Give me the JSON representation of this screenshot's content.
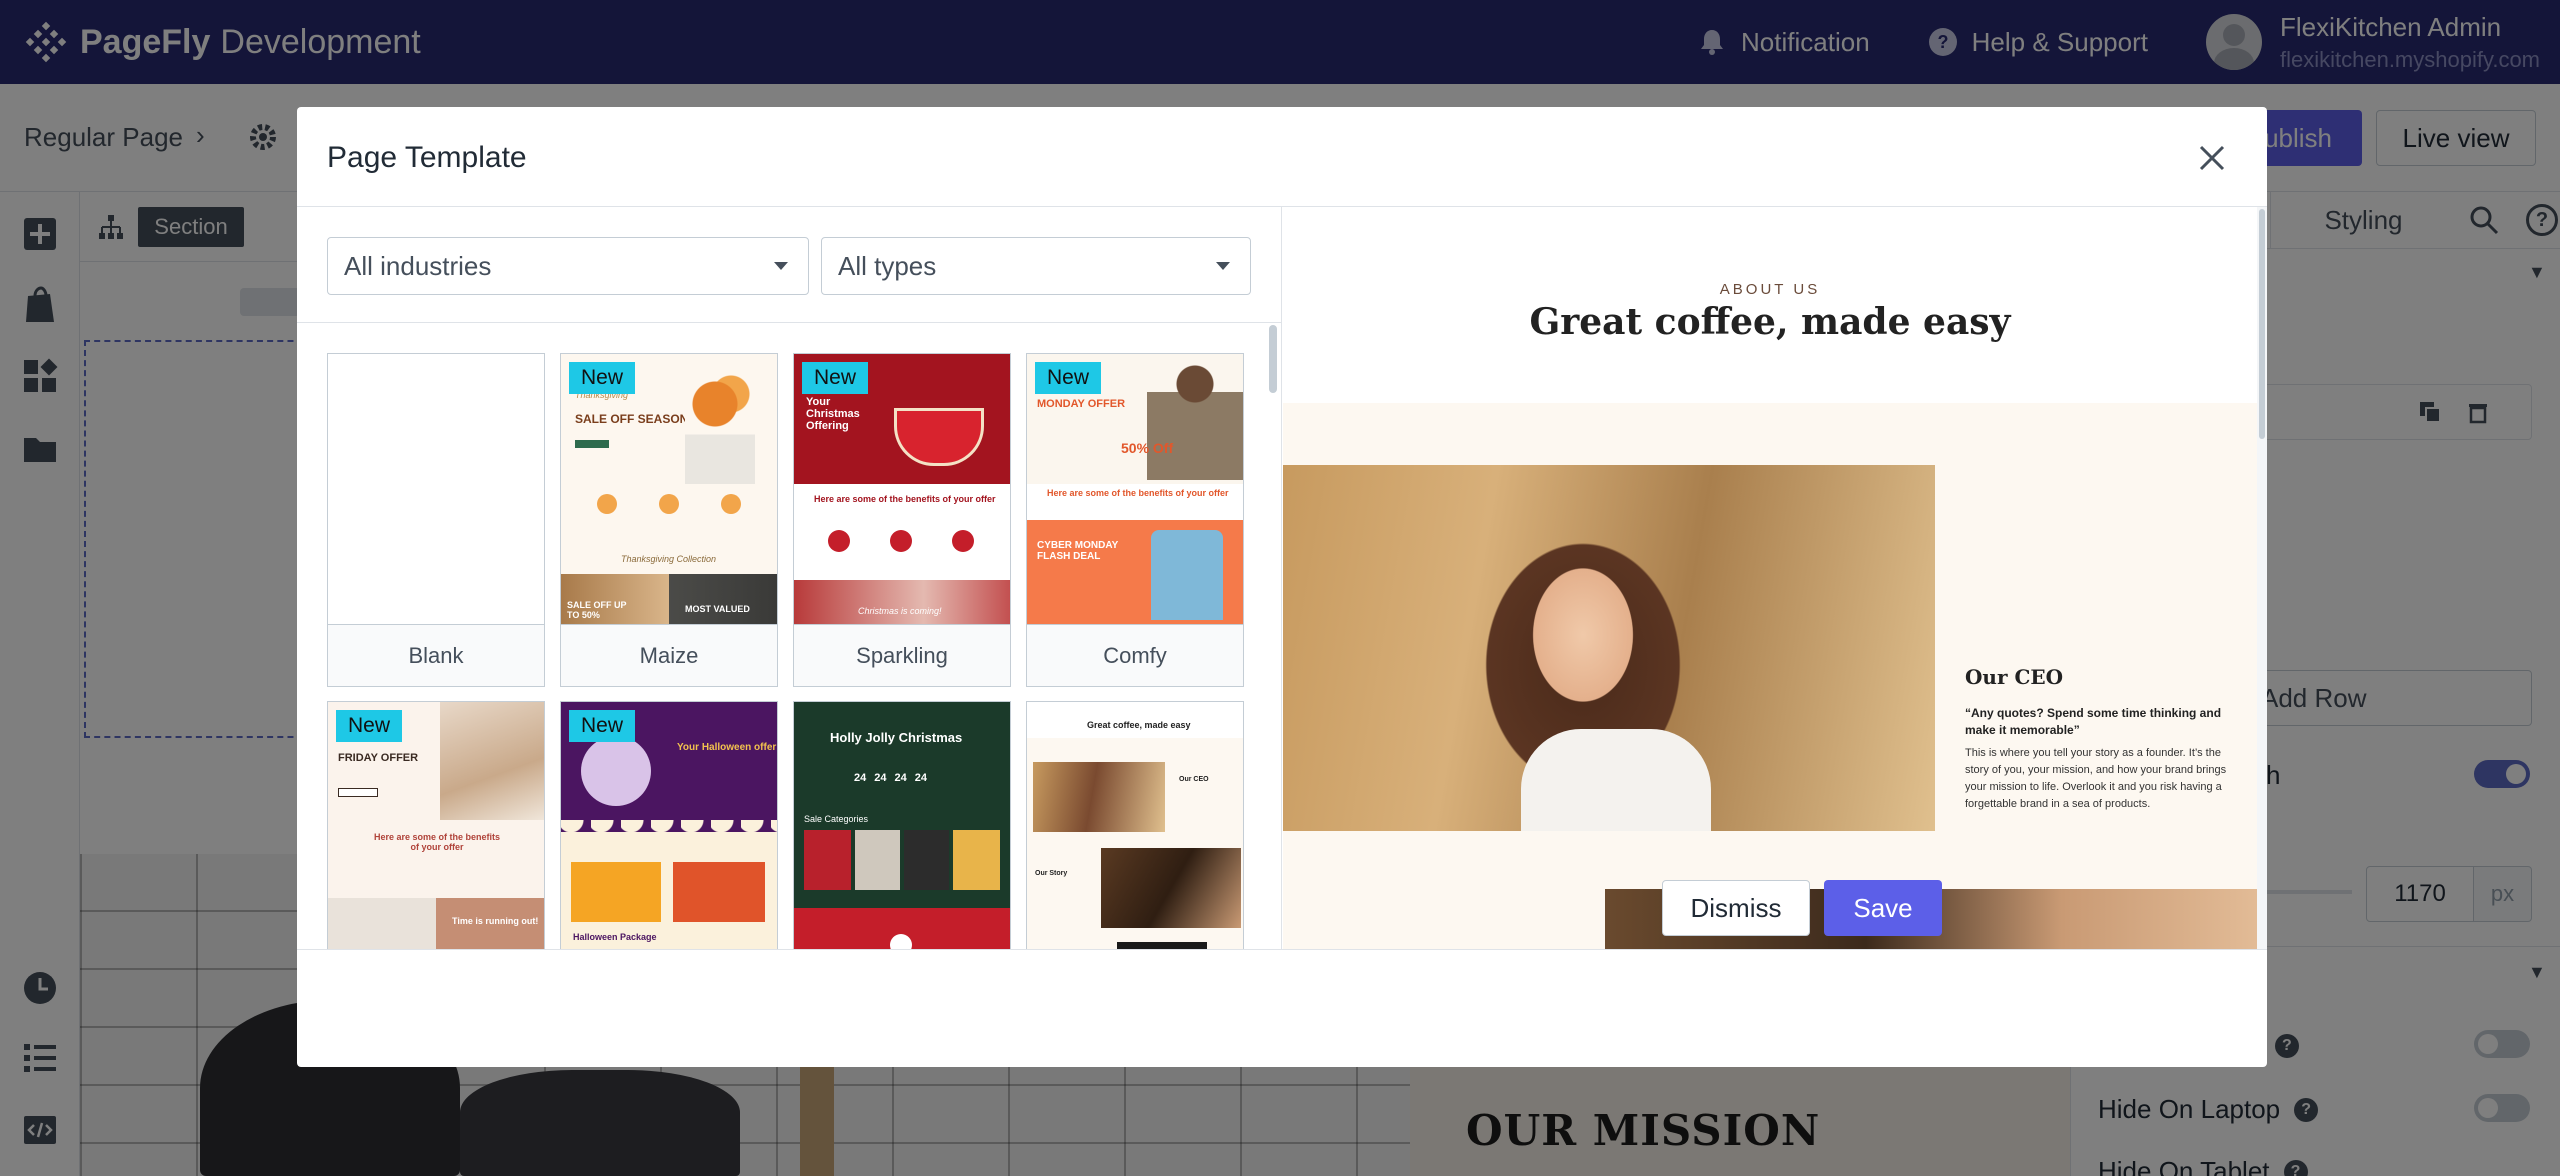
{
  "topbar": {
    "brand": "PageFly",
    "environment": "Development",
    "notification": "Notification",
    "help": "Help & Support",
    "account_name": "FlexiKitchen Admin",
    "account_store": "flexikitchen.myshopify.com"
  },
  "editor": {
    "breadcrumb": "Regular Page",
    "section_chip": "Section",
    "publish_label": "ublish",
    "live_view_label": "Live view",
    "styling_tab": "Styling",
    "add_row": "Add Row",
    "toggle_label_fragment": "h",
    "width_value": "1170",
    "width_unit": "px",
    "row_desktop_fragment": "op",
    "row_laptop": "Hide On Laptop",
    "row_tablet": "Hide On Tablet",
    "canvas_heading": "OUR MISSION"
  },
  "modal": {
    "title": "Page Template",
    "industries_select": "All industries",
    "types_select": "All types",
    "templates": [
      {
        "name": "Blank",
        "badge": ""
      },
      {
        "name": "Maize",
        "badge": "New"
      },
      {
        "name": "Sparkling",
        "badge": "New"
      },
      {
        "name": "Comfy",
        "badge": "New"
      },
      {
        "name": "",
        "badge": "New"
      },
      {
        "name": "",
        "badge": "New"
      },
      {
        "name": "",
        "badge": ""
      },
      {
        "name": "",
        "badge": ""
      }
    ],
    "thumb_text": {
      "maize_head": "SALE OFF SEASON",
      "maize_script": "Thanksgiving",
      "maize_collection": "Thanksgiving Collection",
      "maize_sale": "SALE OFF UP TO 50%",
      "maize_most": "MOST VALUED",
      "sparkling_head": "Your Christmas Offering",
      "sparkling_benefits": "Here are some of the benefits of your offer",
      "sparkling_coming": "Christmas is coming!",
      "comfy_head": "MONDAY OFFER",
      "comfy_pct": "50% Off",
      "comfy_benefits": "Here are some of the benefits of your offer",
      "comfy_flash": "CYBER MONDAY FLASH DEAL",
      "bf_head": "FRIDAY OFFER",
      "bf_benefits": "Here are some of the benefits of your offer",
      "bf_time": "Time is running out!",
      "hw_head": "Your Halloween offer",
      "hw_pkg": "Halloween Package",
      "xmas_head": "Holly Jolly Christmas",
      "xmas_count": [
        "24",
        "24",
        "24",
        "24"
      ],
      "xmas_sub": "Sale Categories",
      "coffee_head": "Great coffee, made easy",
      "coffee_ceo": "Our CEO",
      "coffee_story": "Our Story"
    },
    "preview": {
      "kicker": "ABOUT US",
      "title": "Great coffee, made easy",
      "ceo_heading": "Our CEO",
      "quote": "“Any quotes? Spend some time thinking and make it memorable”",
      "body": "This is where you tell your story as a founder. It’s the story of you, your mission, and how your brand brings your mission to life. Overlook it and you risk having a forgettable brand in a sea of products."
    },
    "dismiss_label": "Dismiss",
    "save_label": "Save"
  },
  "colors": {
    "topbar": "#282a72",
    "primary": "#5c5fe8",
    "badge": "#1ec8e6"
  }
}
